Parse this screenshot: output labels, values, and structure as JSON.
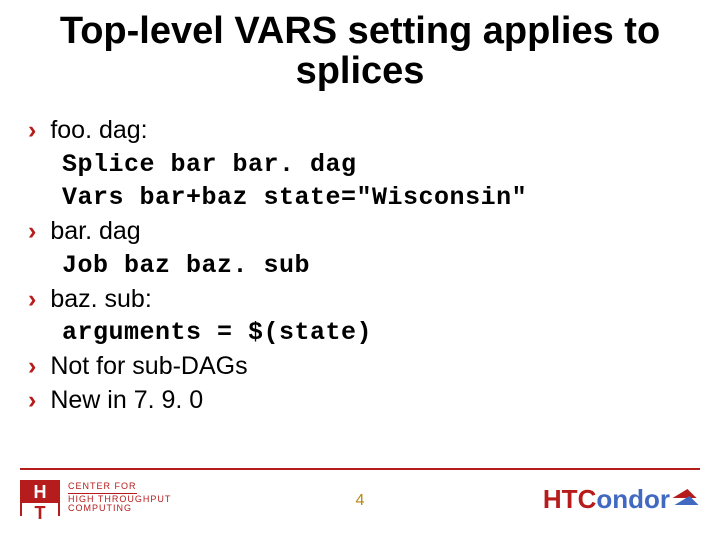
{
  "title": "Top-level VARS setting applies to splices",
  "bullets": {
    "b1": "foo. dag:",
    "b1_code1": "Splice bar bar. dag",
    "b1_code2": "Vars bar+baz state=\"Wisconsin\"",
    "b2": "bar. dag",
    "b2_code1": "Job baz baz. sub",
    "b3": "baz. sub:",
    "b3_code1": "arguments = $(state)",
    "b4": "Not for sub-DAGs",
    "b5": "New in 7. 9. 0"
  },
  "page_number": "4",
  "logo_left": {
    "H": "H",
    "T": "T",
    "line1": "CENTER FOR",
    "line2": "HIGH THROUGHPUT",
    "line3": "COMPUTING"
  },
  "logo_right": {
    "ht": "HTC",
    "ondor": "ondor"
  }
}
